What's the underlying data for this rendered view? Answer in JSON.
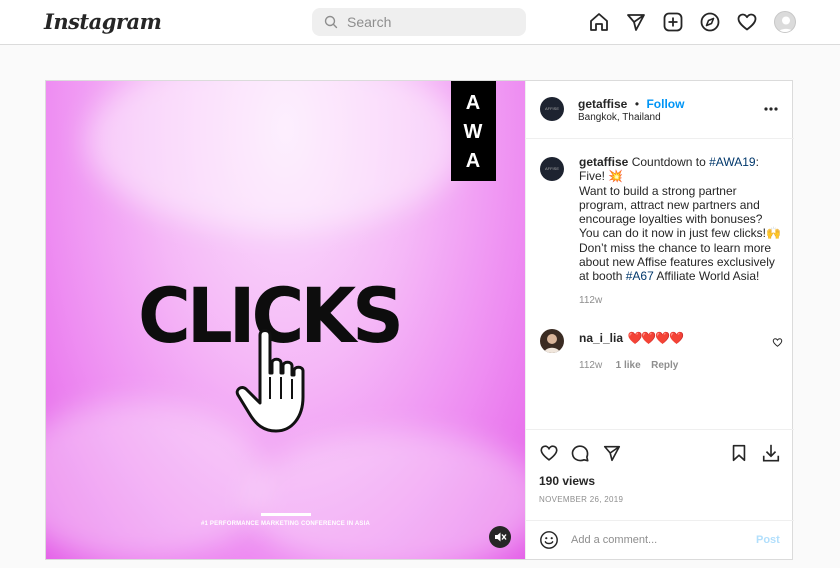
{
  "nav": {
    "logo": "Instagram",
    "search_placeholder": "Search",
    "icons": [
      "home-icon",
      "direct-icon",
      "new-post-icon",
      "explore-icon",
      "activity-icon",
      "profile-avatar"
    ]
  },
  "post": {
    "media": {
      "badge": "AWA",
      "headline": "CLICKS",
      "subline": "#1 PERFORMANCE MARKETING CONFERENCE IN ASIA"
    },
    "header": {
      "username": "getaffise",
      "dot": "•",
      "follow_label": "Follow",
      "location": "Bangkok, Thailand",
      "avatar_text": "AFFISE"
    },
    "caption": {
      "username": "getaffise",
      "text_1": "Countdown to ",
      "tag_1": "#AWA19",
      "text_2": ": Five! 💥",
      "text_3": "Want to build a strong partner program, attract new partners and encourage loyalties with bonuses? You can do it now in just few clicks!🙌Don’t miss the chance to learn more about new Affise features exclusively at booth ",
      "tag_2": "#A67",
      "text_4": " Affiliate World Asia!",
      "time": "112w"
    },
    "comment": {
      "username": "na_i_lia",
      "text": "❤️❤️❤️❤️",
      "time": "112w",
      "likes": "1 like",
      "reply_label": "Reply"
    },
    "views": "190 views",
    "date": "NOVEMBER 26, 2019",
    "add_comment_placeholder": "Add a comment...",
    "post_label": "Post"
  },
  "colors": {
    "accent": "#0095f6",
    "post_disabled": "#b2dffc"
  }
}
